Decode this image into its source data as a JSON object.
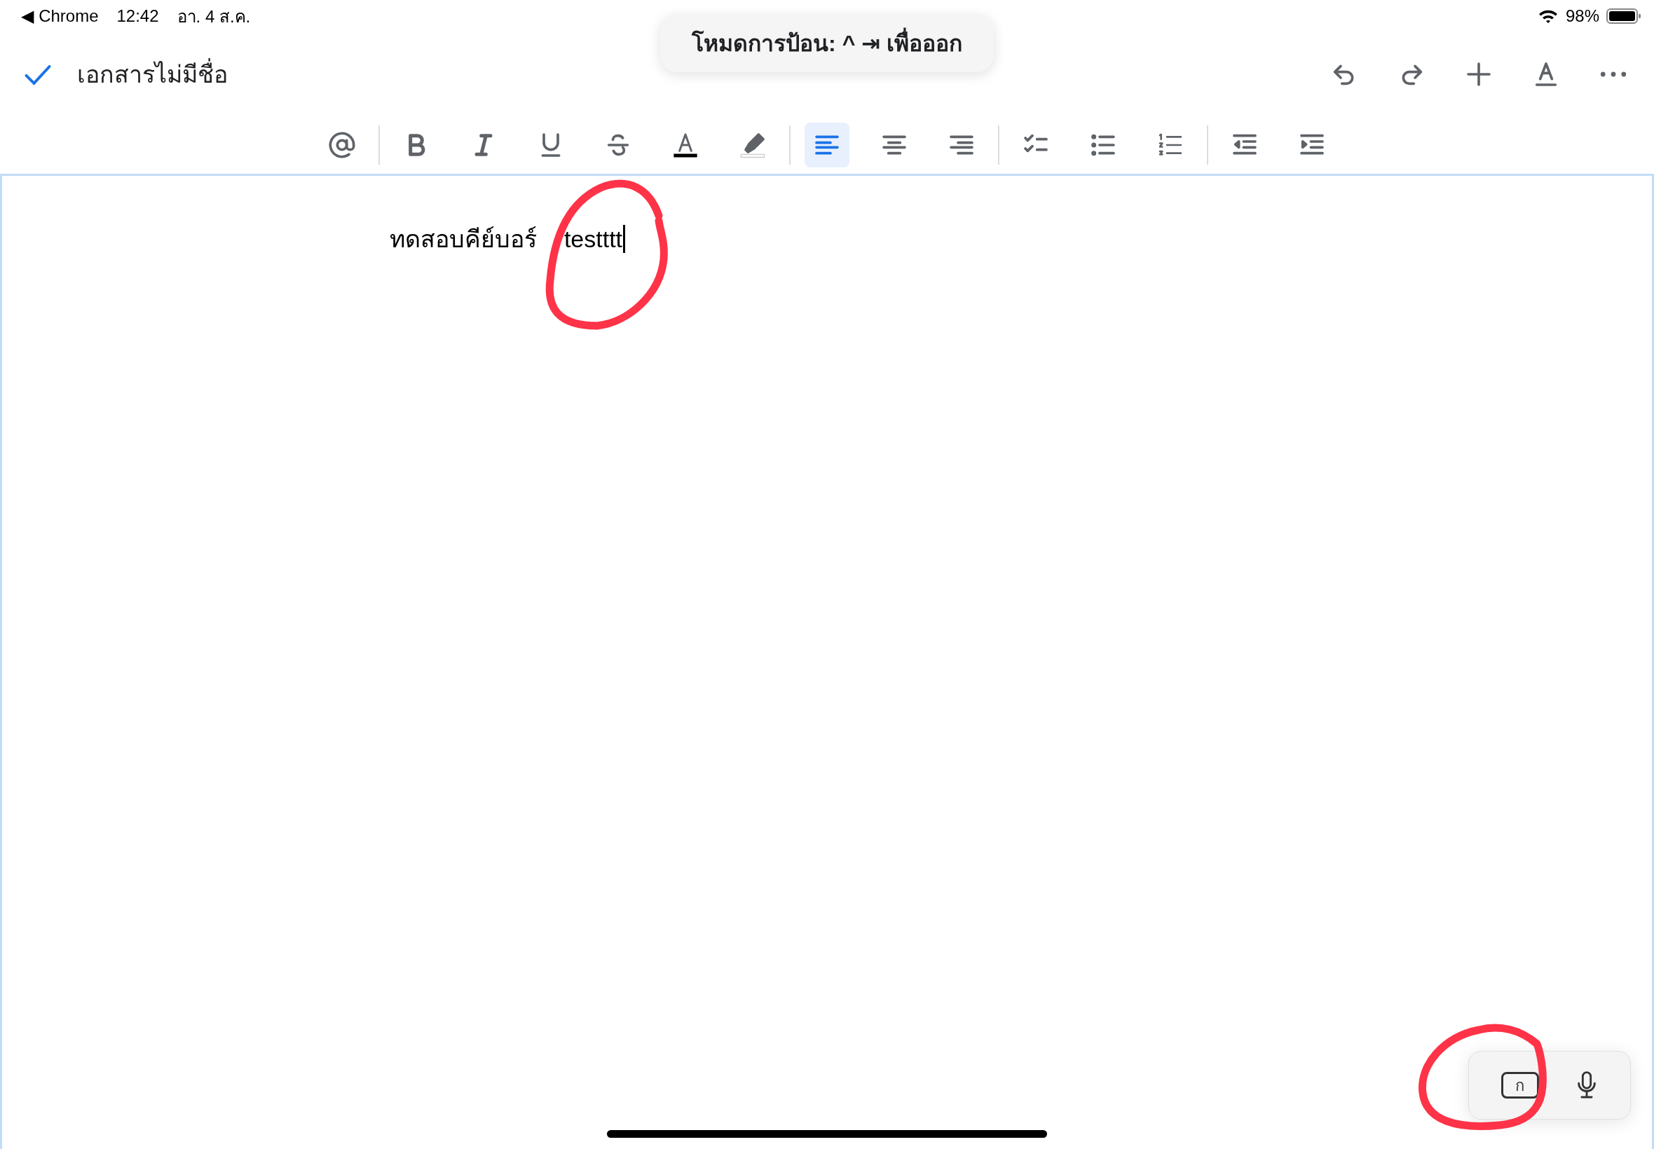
{
  "status_bar": {
    "back_app": "◀ Chrome",
    "time": "12:42",
    "date": "อา. 4 ส.ค.",
    "battery": "98%"
  },
  "toast": {
    "text": "โหมดการป้อน: ^ ⇥ เพื่อออก"
  },
  "header": {
    "title": "เอกสารไม่มีชื่อ",
    "actions": [
      {
        "kind": "undo"
      },
      {
        "kind": "redo"
      },
      {
        "kind": "add"
      },
      {
        "kind": "text-format"
      },
      {
        "kind": "more"
      }
    ]
  },
  "toolbar": [
    [
      {
        "kind": "mention",
        "selected": false
      }
    ],
    [
      {
        "kind": "bold",
        "selected": false
      },
      {
        "kind": "italic",
        "selected": false
      },
      {
        "kind": "underline",
        "selected": false
      },
      {
        "kind": "strikethrough",
        "selected": false
      },
      {
        "kind": "text-color",
        "selected": false
      },
      {
        "kind": "highlight",
        "selected": false
      }
    ],
    [
      {
        "kind": "align-left",
        "selected": true
      },
      {
        "kind": "align-center",
        "selected": false
      },
      {
        "kind": "align-right",
        "selected": false
      }
    ],
    [
      {
        "kind": "checklist",
        "selected": false
      },
      {
        "kind": "bullets",
        "selected": false
      },
      {
        "kind": "numbered",
        "selected": false
      }
    ],
    [
      {
        "kind": "outdent",
        "selected": false
      },
      {
        "kind": "indent",
        "selected": false
      }
    ]
  ],
  "document": {
    "text": "ทดสอบคีย์บอร์  testttt"
  },
  "input_panel": {
    "key_label": "ก"
  }
}
